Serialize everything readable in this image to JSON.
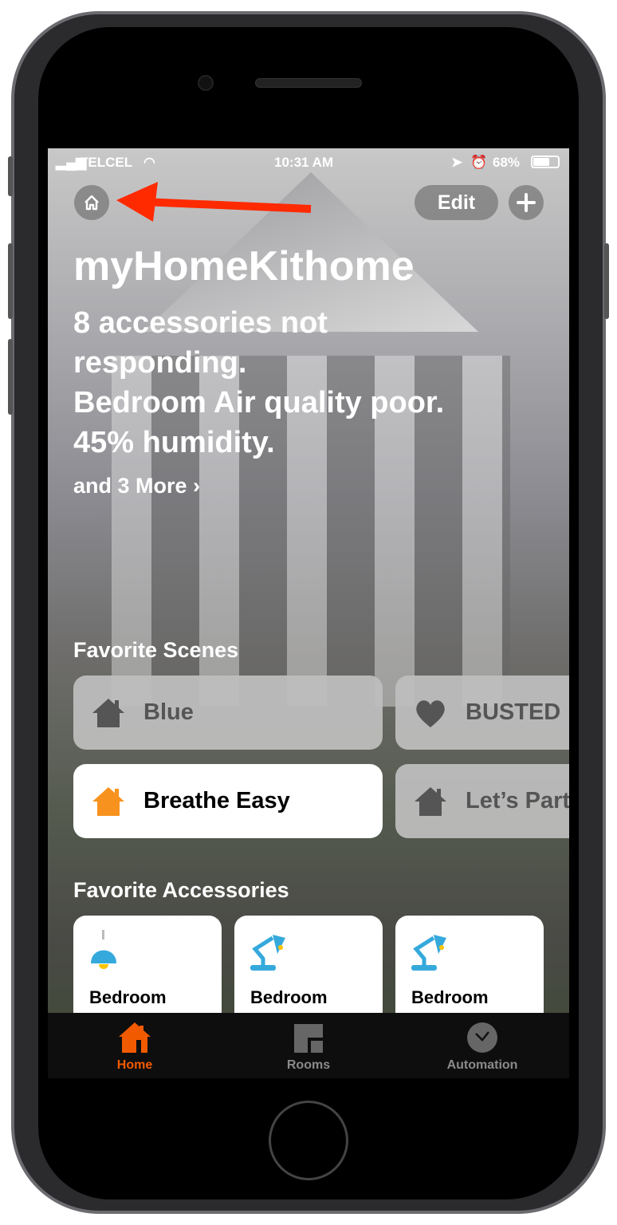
{
  "status_bar": {
    "carrier": "TELCEL",
    "time": "10:31 AM",
    "battery": "68%"
  },
  "header": {
    "home_icon": "house-outline-icon",
    "edit_label": "Edit",
    "add_icon": "plus-icon"
  },
  "annotation": {
    "arrow_color": "#ff2a00"
  },
  "home": {
    "title": "myHomeKithome",
    "summary": [
      "8 accessories not",
      "responding.",
      "Bedroom Air quality poor.",
      "45% humidity."
    ],
    "more_label": "and 3 More ›"
  },
  "favorite_scenes": {
    "title": "Favorite Scenes",
    "items": [
      {
        "label": "Blue",
        "icon": "house-icon",
        "active": false
      },
      {
        "label": "BUSTED",
        "icon": "heart-icon",
        "active": false
      },
      {
        "label": "Breathe Easy",
        "icon": "house-icon",
        "active": true
      },
      {
        "label": "Let’s Party",
        "icon": "house-icon",
        "active": false
      }
    ]
  },
  "favorite_accessories": {
    "title": "Favorite Accessories",
    "items": [
      {
        "label": "Bedroom",
        "icon": "pendant-lamp-icon"
      },
      {
        "label": "Bedroom",
        "icon": "desk-lamp-icon"
      },
      {
        "label": "Bedroom",
        "icon": "desk-lamp-icon"
      }
    ]
  },
  "tabs": [
    {
      "label": "Home",
      "active": true
    },
    {
      "label": "Rooms",
      "active": false
    },
    {
      "label": "Automation",
      "active": false
    }
  ],
  "colors": {
    "accent": "#f25a00",
    "scene_active_icon": "#f7921e",
    "lamp": "#35a9dc"
  }
}
